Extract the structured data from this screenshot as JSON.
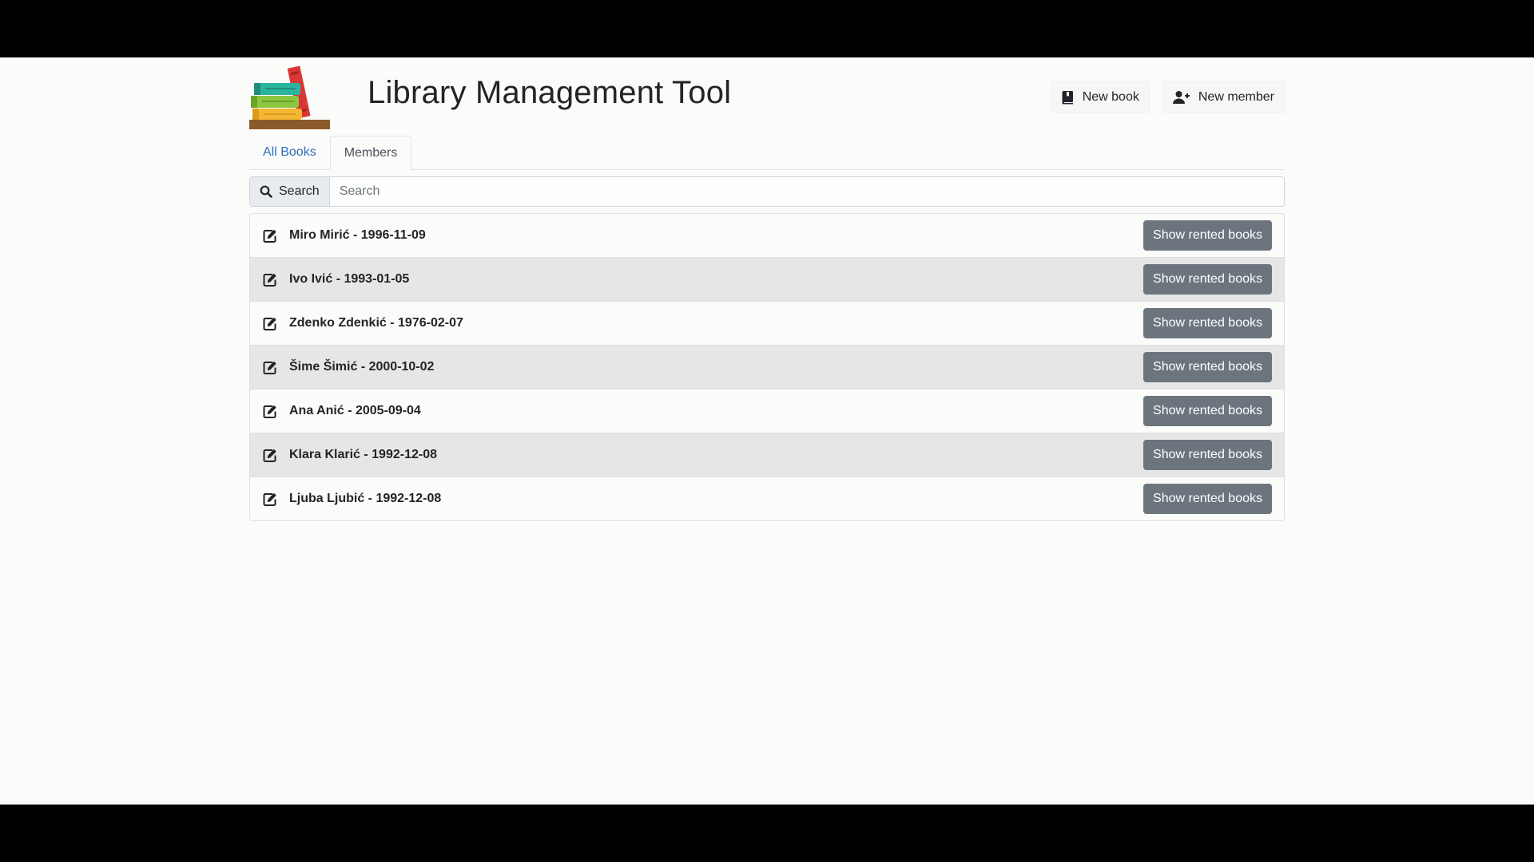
{
  "header": {
    "title": "Library Management Tool",
    "new_book_label": "New book",
    "new_member_label": "New member"
  },
  "tabs": [
    {
      "label": "All Books",
      "active": false
    },
    {
      "label": "Members",
      "active": true
    }
  ],
  "search": {
    "button_label": "Search",
    "placeholder": "Search",
    "value": ""
  },
  "members": [
    {
      "text": "Miro Mirić - 1996-11-09",
      "action_label": "Show rented books"
    },
    {
      "text": "Ivo Ivić - 1993-01-05",
      "action_label": "Show rented books"
    },
    {
      "text": "Zdenko Zdenkić - 1976-02-07",
      "action_label": "Show rented books"
    },
    {
      "text": "Šime Šimić - 2000-10-02",
      "action_label": "Show rented books"
    },
    {
      "text": "Ana Anić - 2005-09-04",
      "action_label": "Show rented books"
    },
    {
      "text": "Klara Klarić - 1992-12-08",
      "action_label": "Show rented books"
    },
    {
      "text": "Ljuba Ljubić - 1992-12-08",
      "action_label": "Show rented books"
    }
  ],
  "colors": {
    "link": "#2f6fb7",
    "secondary_button": "#6c757d",
    "striped_row": "#e6e6e6",
    "page_background": "#fbfbfa"
  },
  "icons": {
    "logo": "books-stack-logo",
    "new_book": "book-icon",
    "new_member": "user-plus-icon",
    "search": "search-icon",
    "edit": "edit-icon"
  }
}
